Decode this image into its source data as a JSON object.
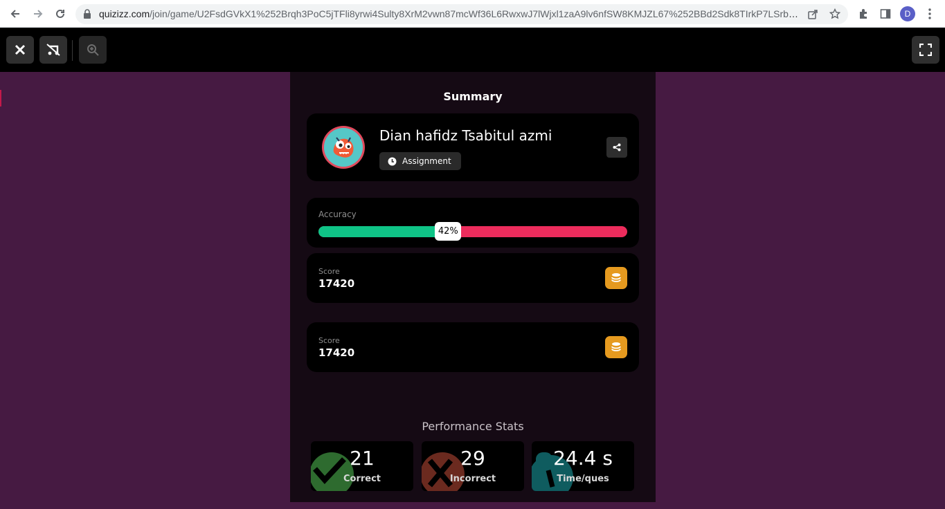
{
  "browser": {
    "url_host": "quizizz.com",
    "url_path": "/join/game/U2FsdGVkX1%252Brqh3PoC5jTFli8yrwi4Sulty8XrM2vwn87mcWf36L6RwxwJ7lWjxl1zaA9lv6nfSW8KMJZL67%252BBd2Sdk8TIrkP7LSrbI88Kw...",
    "profile_initial": "D"
  },
  "summary": {
    "title": "Summary",
    "player_name": "Dian hafidz Tsabitul azmi",
    "mode_label": "Assignment"
  },
  "accuracy": {
    "label": "Accuracy",
    "value_text": "42%",
    "value": 0.42,
    "colors": {
      "correct": "#0fc487",
      "incorrect": "#ec2c5c"
    }
  },
  "scores": [
    {
      "label": "Score",
      "value": "17420"
    },
    {
      "label": "Score",
      "value": "17420"
    }
  ],
  "performance": {
    "title": "Performance Stats",
    "stats": [
      {
        "value": "21",
        "label": "Correct",
        "icon": "check-icon",
        "color": "#2e6b2f"
      },
      {
        "value": "29",
        "label": "Incorrect",
        "icon": "cross-icon",
        "color": "#6b2a1f"
      },
      {
        "value": "24.4 s",
        "label": "Time/ques",
        "icon": "timer-icon",
        "color": "#0f5c5f"
      }
    ]
  }
}
